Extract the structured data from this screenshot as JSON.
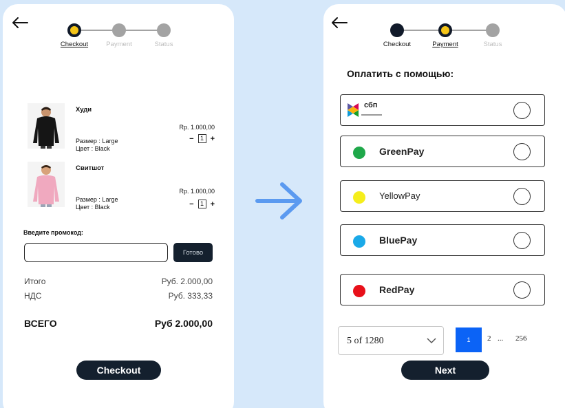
{
  "cart": {
    "steps": [
      {
        "label": "Checkout"
      },
      {
        "label": "Payment"
      },
      {
        "label": "Status"
      }
    ],
    "items": [
      {
        "name": "Худи",
        "size": "Размер   : Large",
        "color": "Цвет : Black",
        "price": "Rp. 1.000,00",
        "qty": "1"
      },
      {
        "name": "Свитшот",
        "size": "Размер   : Large",
        "color": "Цвет : Black",
        "price": "Rp. 1.000,00",
        "qty": "1"
      }
    ],
    "promo": {
      "label": "Введите промокод:",
      "value": "",
      "button": "Готово"
    },
    "summary": {
      "subtotal_label": "Итого",
      "subtotal_value": "Руб. 2.000,00",
      "tax_label": "НДС",
      "tax_value": "Руб. 333,33",
      "total_label": "ВСЕГО",
      "total_value": "Руб 2.000,00"
    },
    "checkout_button": "Checkout"
  },
  "payment": {
    "steps": [
      {
        "label": "Checkout"
      },
      {
        "label": "Payment"
      },
      {
        "label": "Status"
      }
    ],
    "heading": "Оплатить с помощью:",
    "options": [
      {
        "name": "сбп",
        "icon": "sbp-logo-icon"
      },
      {
        "name": "GreenPay",
        "dot_color": "#1fa84a"
      },
      {
        "name": "YellowPay",
        "dot_color": "#f5ee1c"
      },
      {
        "name": "BluePay",
        "dot_color": "#1aa9e8"
      },
      {
        "name": "RedPay",
        "dot_color": "#e8101a"
      }
    ],
    "pager": {
      "select_value": "5 of 1280",
      "active_page": "1",
      "page_2": "2",
      "ellipsis": "...",
      "last_page": "256"
    },
    "next_button": "Next"
  },
  "colors": {
    "dark": "#14202e",
    "accent": "#f5c518",
    "page_active": "#0b63f6",
    "arrow": "#5b9af0",
    "background": "#d6e8fa"
  }
}
